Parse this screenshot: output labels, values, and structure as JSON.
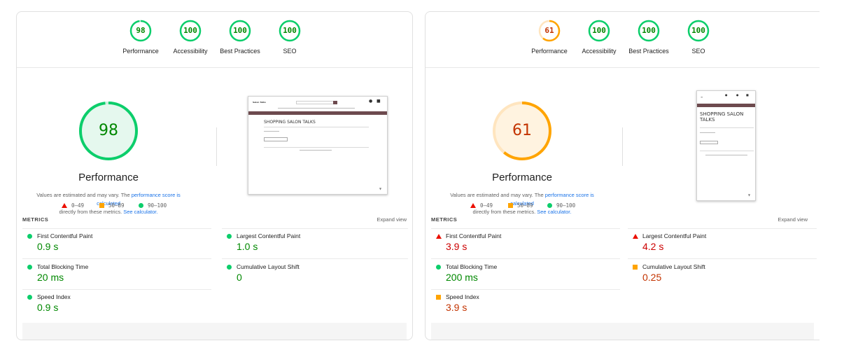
{
  "colors": {
    "pass": "#0cce6b",
    "pass_text": "#008800",
    "average": "#ffa400",
    "average_text": "#c33300",
    "fail": "#eb0f00",
    "fail_text": "#cc0000",
    "link": "#1a73e8"
  },
  "reports": [
    {
      "categories": [
        {
          "score": "98",
          "label": "Performance",
          "level": "pass"
        },
        {
          "score": "100",
          "label": "Accessibility",
          "level": "pass"
        },
        {
          "score": "100",
          "label": "Best Practices",
          "level": "pass"
        },
        {
          "score": "100",
          "label": "SEO",
          "level": "pass"
        }
      ],
      "main_score": "98",
      "main_score_fraction": 0.98,
      "main_title": "Performance",
      "desc_prefix": "Values are estimated and may vary. The ",
      "desc_link": "performance score is calculated",
      "desc_middle": " directly from these metrics. ",
      "desc_link2": "See calculator.",
      "legend": {
        "fail": "0–49",
        "average": "50–89",
        "pass": "90–100"
      },
      "metrics_title": "METRICS",
      "expand_label": "Expand view",
      "metrics": [
        {
          "label": "First Contentful Paint",
          "value": "0.9 s",
          "level": "pass"
        },
        {
          "label": "Largest Contentful Paint",
          "value": "1.0 s",
          "level": "pass"
        },
        {
          "label": "Total Blocking Time",
          "value": "20 ms",
          "level": "pass"
        },
        {
          "label": "Cumulative Layout Shift",
          "value": "0",
          "level": "pass"
        },
        {
          "label": "Speed Index",
          "value": "0.9 s",
          "level": "pass"
        }
      ],
      "screenshot": {
        "heading": "SHOPPING SALON TALKS"
      }
    },
    {
      "categories": [
        {
          "score": "61",
          "label": "Performance",
          "level": "average"
        },
        {
          "score": "100",
          "label": "Accessibility",
          "level": "pass"
        },
        {
          "score": "100",
          "label": "Best Practices",
          "level": "pass"
        },
        {
          "score": "100",
          "label": "SEO",
          "level": "pass"
        }
      ],
      "main_score": "61",
      "main_score_fraction": 0.61,
      "main_title": "Performance",
      "desc_prefix": "Values are estimated and may vary. The ",
      "desc_link": "performance score is calculated",
      "desc_middle": " directly from these metrics. ",
      "desc_link2": "See calculator.",
      "legend": {
        "fail": "0–49",
        "average": "50–89",
        "pass": "90–100"
      },
      "metrics_title": "METRICS",
      "expand_label": "Expand view",
      "metrics": [
        {
          "label": "First Contentful Paint",
          "value": "3.9 s",
          "level": "fail"
        },
        {
          "label": "Largest Contentful Paint",
          "value": "4.2 s",
          "level": "fail"
        },
        {
          "label": "Total Blocking Time",
          "value": "200 ms",
          "level": "pass"
        },
        {
          "label": "Cumulative Layout Shift",
          "value": "0.25",
          "level": "average"
        },
        {
          "label": "Speed Index",
          "value": "3.9 s",
          "level": "average"
        }
      ],
      "screenshot": {
        "heading": "SHOPPING SALON TALKS"
      }
    }
  ]
}
